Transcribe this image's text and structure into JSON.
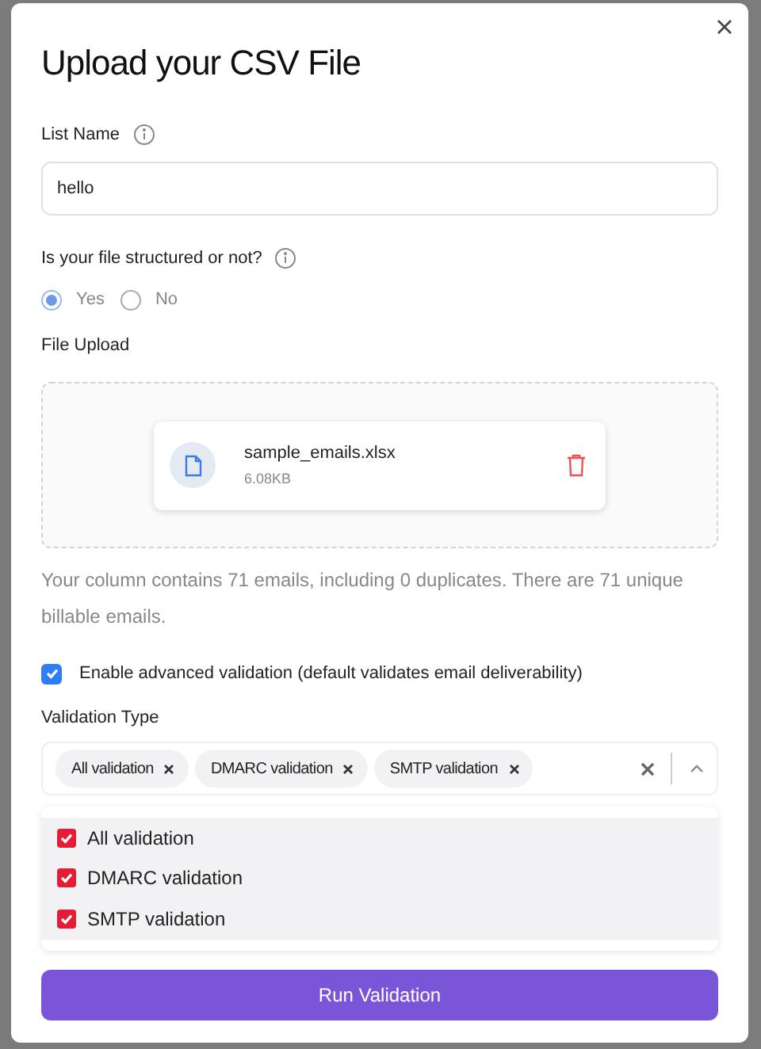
{
  "dialog": {
    "title": "Upload your CSV File"
  },
  "list_name": {
    "label": "List Name",
    "value": "hello"
  },
  "structured": {
    "label": "Is your file structured or not?",
    "options": [
      {
        "label": "Yes",
        "selected": true
      },
      {
        "label": "No",
        "selected": false
      }
    ]
  },
  "file_upload": {
    "label": "File Upload",
    "file_name": "sample_emails.xlsx",
    "file_size": "6.08KB"
  },
  "summary": "Your column contains 71 emails, including 0 duplicates. There are 71 unique billable emails.",
  "advanced": {
    "label": "Enable advanced validation (default validates email deliverability)",
    "checked": true
  },
  "validation_type": {
    "label": "Validation Type",
    "chips": [
      "All validation",
      "DMARC validation",
      "SMTP validation"
    ],
    "expanded": true,
    "options": [
      {
        "label": "All validation",
        "checked": true
      },
      {
        "label": "DMARC validation",
        "checked": true
      },
      {
        "label": "SMTP validation",
        "checked": true
      }
    ]
  },
  "submit": "Run Validation"
}
